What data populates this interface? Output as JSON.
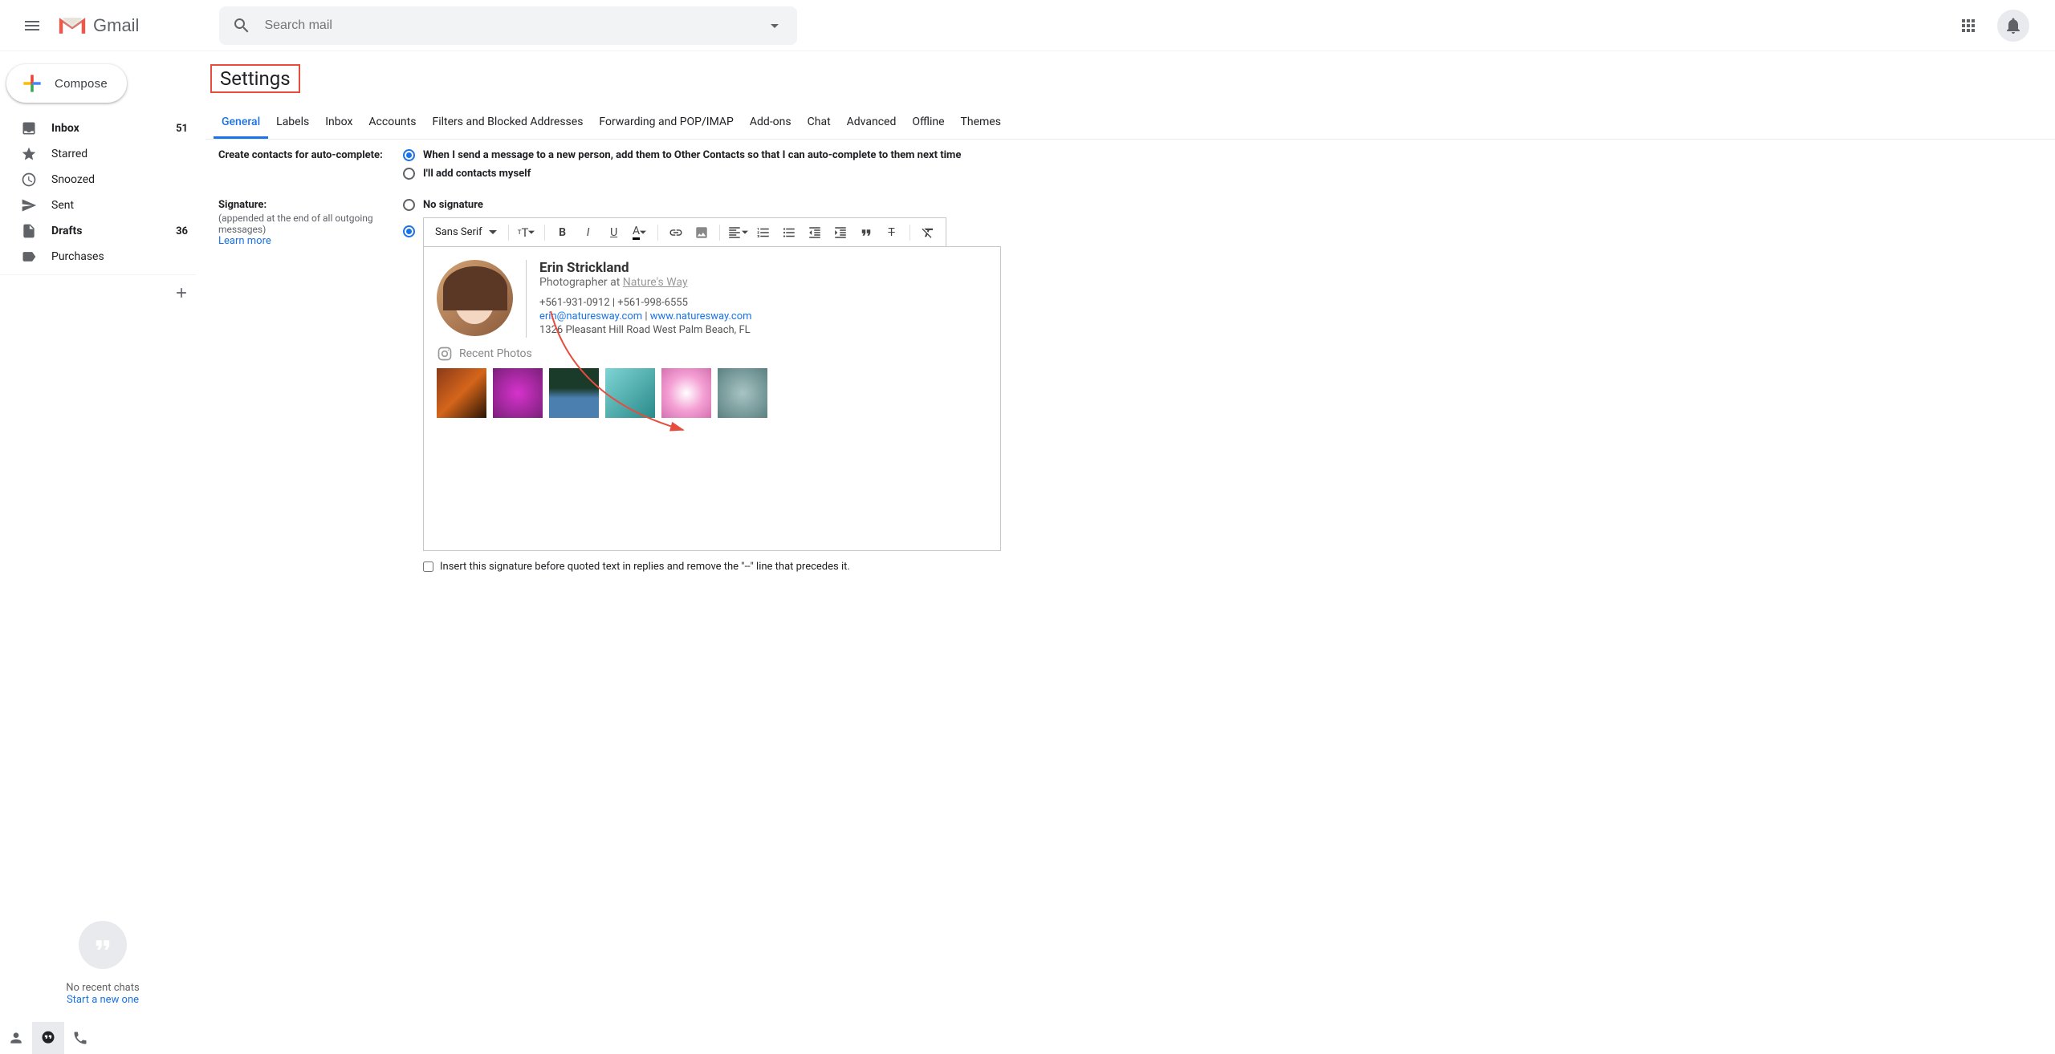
{
  "header": {
    "logo_text": "Gmail",
    "search_placeholder": "Search mail"
  },
  "compose": {
    "label": "Compose"
  },
  "sidebar": {
    "items": [
      {
        "label": "Inbox",
        "count": "51",
        "bold": true,
        "icon": "inbox"
      },
      {
        "label": "Starred",
        "count": "",
        "bold": false,
        "icon": "star"
      },
      {
        "label": "Snoozed",
        "count": "",
        "bold": false,
        "icon": "clock"
      },
      {
        "label": "Sent",
        "count": "",
        "bold": false,
        "icon": "send"
      },
      {
        "label": "Drafts",
        "count": "36",
        "bold": true,
        "icon": "file"
      },
      {
        "label": "Purchases",
        "count": "",
        "bold": false,
        "icon": "tag"
      }
    ]
  },
  "hangouts": {
    "no_chats": "No recent chats",
    "start_new": "Start a new one"
  },
  "settings": {
    "title": "Settings",
    "tabs": [
      "General",
      "Labels",
      "Inbox",
      "Accounts",
      "Filters and Blocked Addresses",
      "Forwarding and POP/IMAP",
      "Add-ons",
      "Chat",
      "Advanced",
      "Offline",
      "Themes"
    ],
    "active_tab": "General"
  },
  "autocomplete": {
    "label": "Create contacts for auto-complete:",
    "opt1": "When I send a message to a new person, add them to Other Contacts so that I can auto-complete to them next time",
    "opt2": "I'll add contacts myself"
  },
  "signature": {
    "label": "Signature:",
    "sublabel": "(appended at the end of all outgoing messages)",
    "learn_more": "Learn more",
    "no_sig": "No signature",
    "font": "Sans Serif",
    "preview": {
      "name": "Erin Strickland",
      "role_prefix": "Photographer at ",
      "company": "Nature's Way",
      "phone": "+561-931-0912  |  +561-998-6555",
      "email": "erin@naturesway.com",
      "separator": "  |  ",
      "website": "www.naturesway.com",
      "address": "1326 Pleasant Hill Road West Palm Beach, FL",
      "recent_label": "Recent Photos"
    },
    "insert_before": "Insert this signature before quoted text in replies and remove the \"--\" line that precedes it."
  }
}
